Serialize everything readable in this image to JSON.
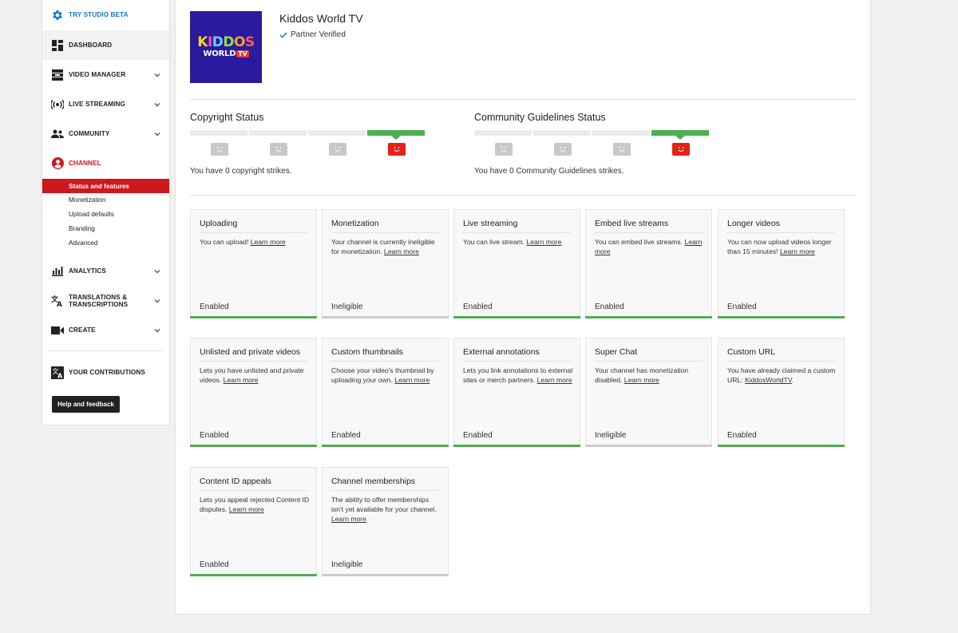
{
  "sidebar": {
    "studio_beta": "TRY STUDIO BETA",
    "dashboard": "DASHBOARD",
    "video_manager": "VIDEO MANAGER",
    "live_streaming": "LIVE STREAMING",
    "community": "COMMUNITY",
    "channel": "CHANNEL",
    "channel_items": [
      "Status and features",
      "Monetization",
      "Upload defaults",
      "Branding",
      "Advanced"
    ],
    "analytics": "ANALYTICS",
    "translations_line1": "TRANSLATIONS &",
    "translations_line2": "TRANSCRIPTIONS",
    "create": "CREATE",
    "contributions": "YOUR CONTRIBUTIONS",
    "help": "Help and feedback"
  },
  "channel": {
    "name": "Kiddos World TV",
    "verified": "Partner Verified",
    "logo_line1": [
      "K",
      "I",
      "D",
      "D",
      "O",
      "S"
    ],
    "logo_line2": "WORLD",
    "logo_tv": "TV"
  },
  "copyright": {
    "title": "Copyright Status",
    "text": "You have 0 copyright strikes."
  },
  "community": {
    "title": "Community Guidelines Status",
    "text": "You have 0 Community Guidelines strikes."
  },
  "cards": [
    {
      "title": "Uploading",
      "desc": "You can upload!",
      "link": "Learn more",
      "status": "Enabled"
    },
    {
      "title": "Monetization",
      "desc": "Your channel is currently ineligible for monetization.",
      "link": "Learn more",
      "status": "Ineligible"
    },
    {
      "title": "Live streaming",
      "desc": "You can live stream.",
      "link": "Learn more",
      "status": "Enabled"
    },
    {
      "title": "Embed live streams",
      "desc": "You can embed live streams.",
      "link": "Learn more",
      "status": "Enabled"
    },
    {
      "title": "Longer videos",
      "desc": "You can now upload videos longer than 15 minutes!",
      "link": "Learn more",
      "status": "Enabled"
    },
    {
      "title": "Unlisted and private videos",
      "desc": "Lets you have unlisted and private videos.",
      "link": "Learn more",
      "status": "Enabled"
    },
    {
      "title": "Custom thumbnails",
      "desc": "Choose your video's thumbnail by uploading your own.",
      "link": "Learn more",
      "status": "Enabled"
    },
    {
      "title": "External annotations",
      "desc": "Lets you link annotations to external sites or merch partners.",
      "link": "Learn more",
      "status": "Enabled"
    },
    {
      "title": "Super Chat",
      "desc": "Your channel has monetization disabled.",
      "link": "Learn more",
      "status": "Ineligible"
    },
    {
      "title": "Custom URL",
      "desc": "You have already claimed a custom URL:",
      "link": "KiddosWorldTV",
      "suffix": ".",
      "status": "Enabled"
    },
    {
      "title": "Content ID appeals",
      "desc": "Lets you appeal rejected Content ID disputes.",
      "link": "Learn more",
      "status": "Enabled"
    },
    {
      "title": "Channel memberships",
      "desc": "The ability to offer memberships isn't yet available for your channel.",
      "link": "Learn more",
      "status": "Ineligible"
    }
  ],
  "colors": {
    "enabled": "#4caf50",
    "ineligible": "#cccccc",
    "accent_red": "#cc181e",
    "studio_blue": "#167ac6"
  }
}
